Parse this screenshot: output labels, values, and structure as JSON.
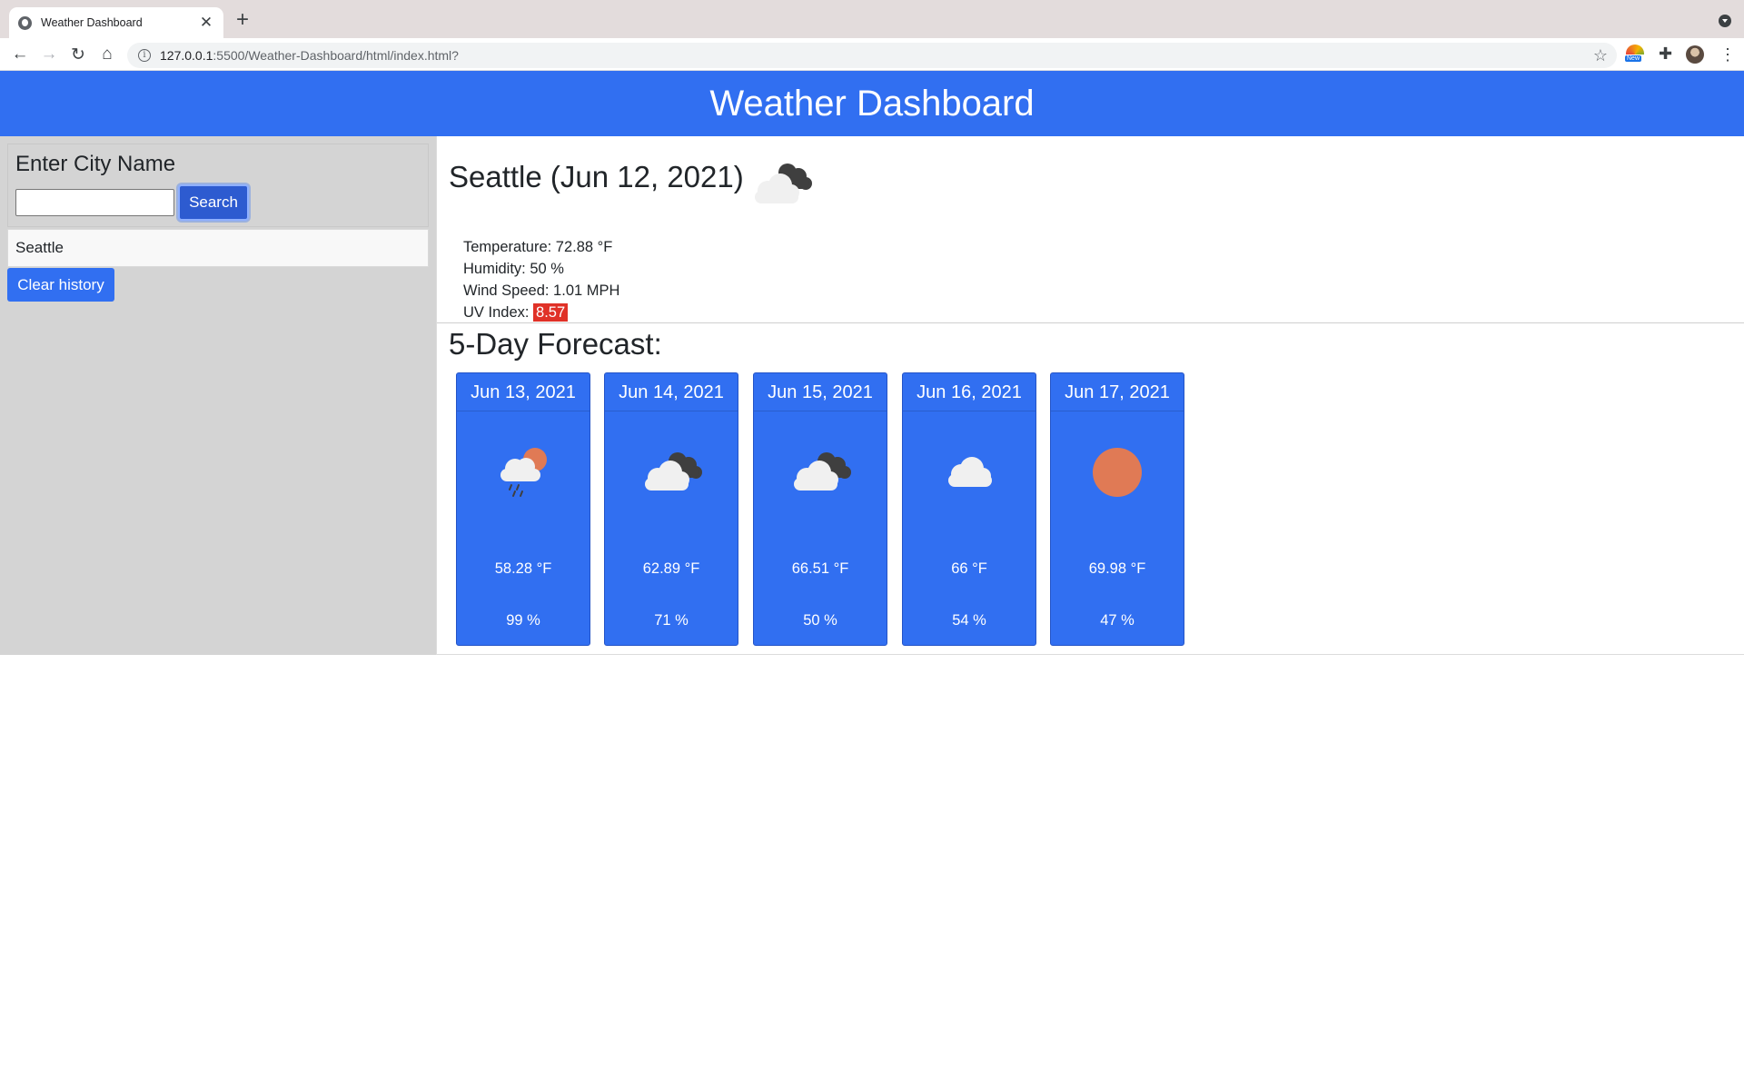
{
  "browser": {
    "tab_title": "Weather Dashboard",
    "new_tab_label": "+",
    "url_host": "127.0.0.1",
    "url_rest": ":5500/Weather-Dashboard/html/index.html?",
    "extension_badge": "New"
  },
  "header": {
    "title": "Weather Dashboard"
  },
  "sidebar": {
    "search_label": "Enter City Name",
    "search_placeholder": "",
    "search_button": "Search",
    "history": [
      "Seattle"
    ],
    "clear_button": "Clear history"
  },
  "current": {
    "title": "Seattle (Jun 12, 2021)",
    "icon": "partly-cloudy-night-icon",
    "temperature": "Temperature: 72.88 °F",
    "humidity": "Humidity: 50 %",
    "wind": "Wind Speed: 1.01 MPH",
    "uv_label": "UV Index: ",
    "uv_value": "8.57",
    "uv_color": "#e03127"
  },
  "forecast": {
    "title": "5-Day Forecast:",
    "days": [
      {
        "date": "Jun 13, 2021",
        "icon": "rain-sun-icon",
        "temp": "58.28 °F",
        "humidity": "99 %"
      },
      {
        "date": "Jun 14, 2021",
        "icon": "cloudy-night-icon",
        "temp": "62.89 °F",
        "humidity": "71 %"
      },
      {
        "date": "Jun 15, 2021",
        "icon": "cloudy-night-icon",
        "temp": "66.51 °F",
        "humidity": "50 %"
      },
      {
        "date": "Jun 16, 2021",
        "icon": "cloud-icon",
        "temp": "66 °F",
        "humidity": "54 %"
      },
      {
        "date": "Jun 17, 2021",
        "icon": "sun-icon",
        "temp": "69.98 °F",
        "humidity": "47 %"
      }
    ]
  },
  "colors": {
    "header_blue": "#316ff1",
    "sidebar_gray": "#d4d4d4",
    "sun_orange": "#e07a55"
  }
}
